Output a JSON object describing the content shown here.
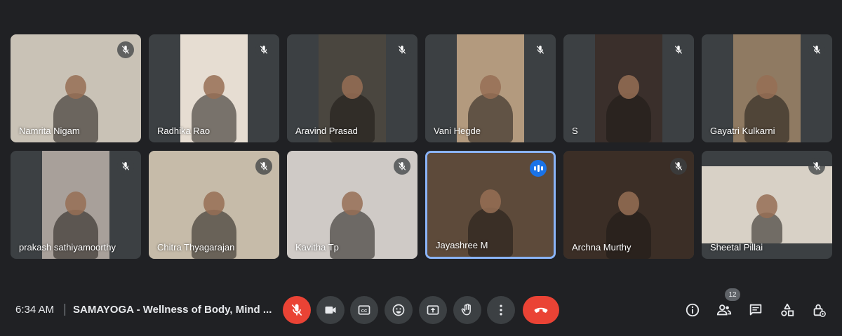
{
  "participants": [
    {
      "name": "Namrita Nigam",
      "mic": "muted",
      "bg": "#c9c2b6"
    },
    {
      "name": "Radhika Rao",
      "mic": "muted",
      "bg": "#e6ddd2"
    },
    {
      "name": "Aravind Prasad",
      "mic": "muted",
      "bg": "#4a463f"
    },
    {
      "name": "Vani Hegde",
      "mic": "muted",
      "bg": "#b39a7e"
    },
    {
      "name": "S",
      "mic": "muted",
      "bg": "#3a2f2b"
    },
    {
      "name": "Gayatri Kulkarni",
      "mic": "muted",
      "bg": "#8f7a62"
    },
    {
      "name": "prakash sathiyamoorthy",
      "mic": "muted",
      "bg": "#a8a09a"
    },
    {
      "name": "Chitra Thyagarajan",
      "mic": "muted",
      "bg": "#c6bba9"
    },
    {
      "name": "Kavitha Tp",
      "mic": "muted",
      "bg": "#cfcac6"
    },
    {
      "name": "Jayashree M",
      "mic": "speaking",
      "bg": "#5d4a3a"
    },
    {
      "name": "Archna Murthy",
      "mic": "muted",
      "bg": "#3b2e26"
    },
    {
      "name": "Sheetal Pillai",
      "mic": "muted",
      "bg": "#d8d1c6"
    }
  ],
  "bottom_bar": {
    "time": "6:34 AM",
    "meeting_title": "SAMAYOGA - Wellness of Body, Mind ...",
    "people_count": "12"
  },
  "controls": {
    "mic": "mic-off-icon",
    "camera": "camera-icon",
    "captions": "closed-captions-icon",
    "reactions": "emoji-icon",
    "present": "present-screen-icon",
    "raise_hand": "raise-hand-icon",
    "more": "more-options-icon",
    "end_call": "end-call-icon"
  },
  "right_icons": [
    "info-icon",
    "people-icon",
    "chat-icon",
    "activities-icon",
    "host-controls-icon"
  ],
  "colors": {
    "background": "#202124",
    "tile": "#3c4043",
    "accent": "#8ab4f8",
    "danger": "#ea4335",
    "speaking": "#1a73e8"
  }
}
